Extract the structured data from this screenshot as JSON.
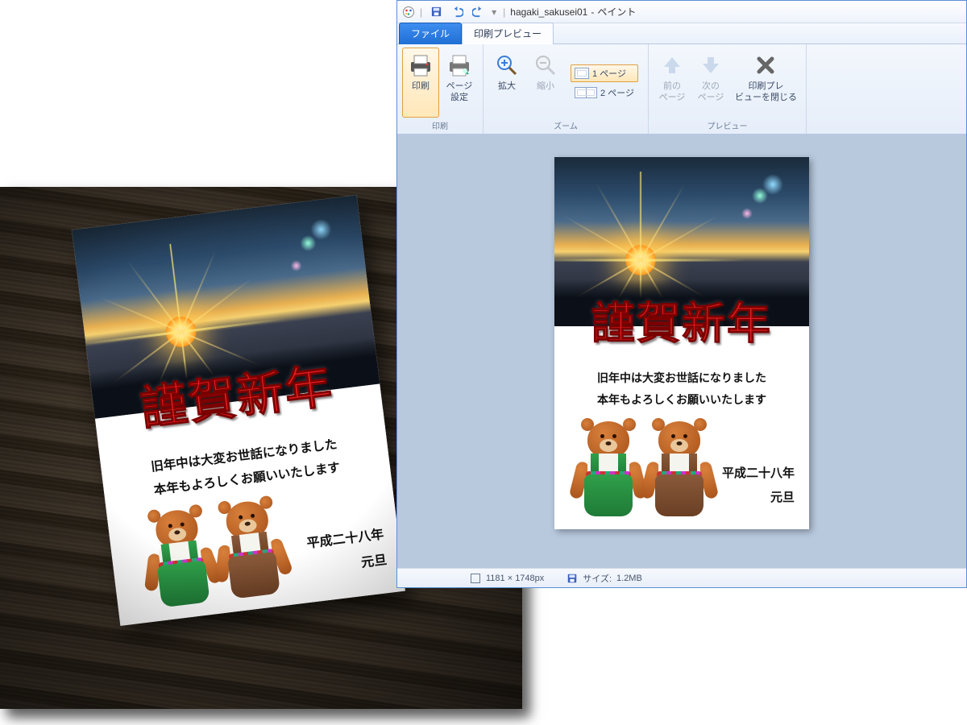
{
  "window": {
    "title_doc": "hagaki_sakusei01",
    "title_app": "ペイント",
    "title_separator": " - "
  },
  "qat": {
    "save": "保存",
    "undo": "元に戻す",
    "redo": "やり直し"
  },
  "tabs": {
    "file": "ファイル",
    "print_preview": "印刷プレビュー"
  },
  "ribbon": {
    "groups": {
      "print": "印刷",
      "zoom": "ズーム",
      "preview": "プレビュー"
    },
    "buttons": {
      "print": "印刷",
      "page_setup_line1": "ページ",
      "page_setup_line2": "設定",
      "zoom_in": "拡大",
      "zoom_out": "縮小",
      "one_page": "1 ページ",
      "two_page": "2 ページ",
      "prev_line1": "前の",
      "prev_line2": "ページ",
      "next_line1": "次の",
      "next_line2": "ページ",
      "close_line1": "印刷プレ",
      "close_line2": "ビューを閉じる"
    }
  },
  "status": {
    "dimensions": "1181 × 1748px",
    "size_label": "サイズ:",
    "size_value": "1.2MB"
  },
  "postcard": {
    "headline": "謹賀新年",
    "body_line1": "旧年中は大変お世話になりました",
    "body_line2": "本年もよろしくお願いいたします",
    "date_line1": "平成二十八年",
    "date_line2": "元旦"
  },
  "colors": {
    "accent_blue": "#1f6fd6",
    "headline_red": "#e42020",
    "ribbon_highlight": "#ffe7b8"
  }
}
